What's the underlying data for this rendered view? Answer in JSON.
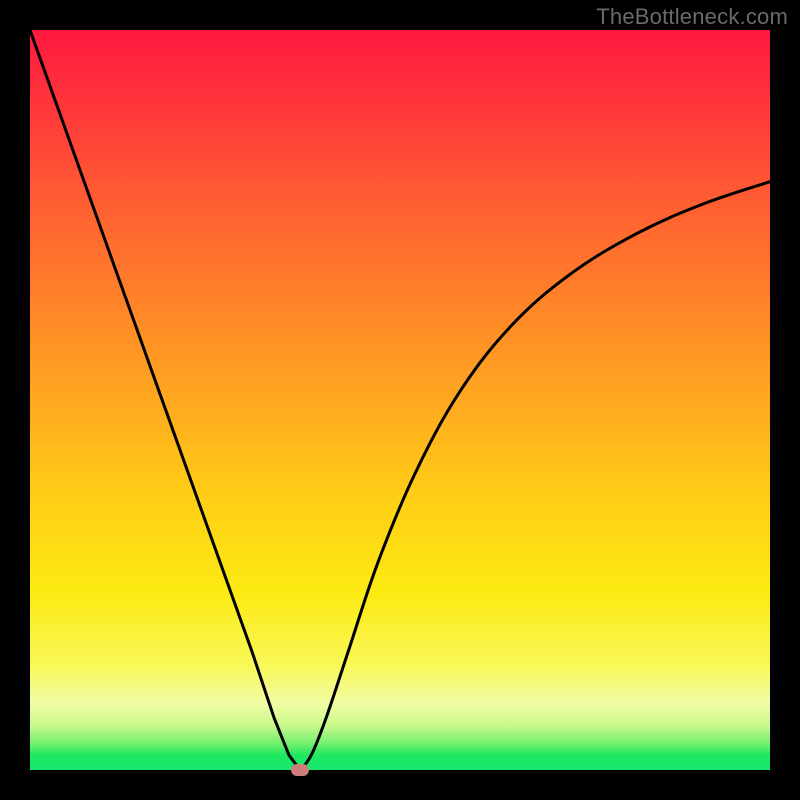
{
  "watermark": "TheBottleneck.com",
  "chart_data": {
    "type": "line",
    "title": "",
    "xlabel": "",
    "ylabel": "",
    "xlim": [
      0,
      100
    ],
    "ylim": [
      0,
      100
    ],
    "grid": false,
    "legend": false,
    "background_gradient": {
      "top_color": "#ff193f",
      "mid_color": "#ffd015",
      "bottom_color": "#16e86d"
    },
    "series": [
      {
        "name": "bottleneck-curve",
        "color": "#000000",
        "x": [
          0,
          5,
          10,
          15,
          20,
          25,
          30,
          33,
          35,
          36.5,
          38,
          40,
          43,
          47,
          52,
          58,
          65,
          73,
          82,
          91,
          100
        ],
        "y": [
          100,
          86,
          72,
          58,
          44,
          30,
          16,
          7,
          2,
          0,
          2,
          7,
          16,
          28,
          40,
          51,
          60,
          67,
          72.5,
          76.5,
          79.5
        ]
      }
    ],
    "marker": {
      "x": 36.5,
      "y": 0,
      "color": "#cd7e7b"
    }
  }
}
